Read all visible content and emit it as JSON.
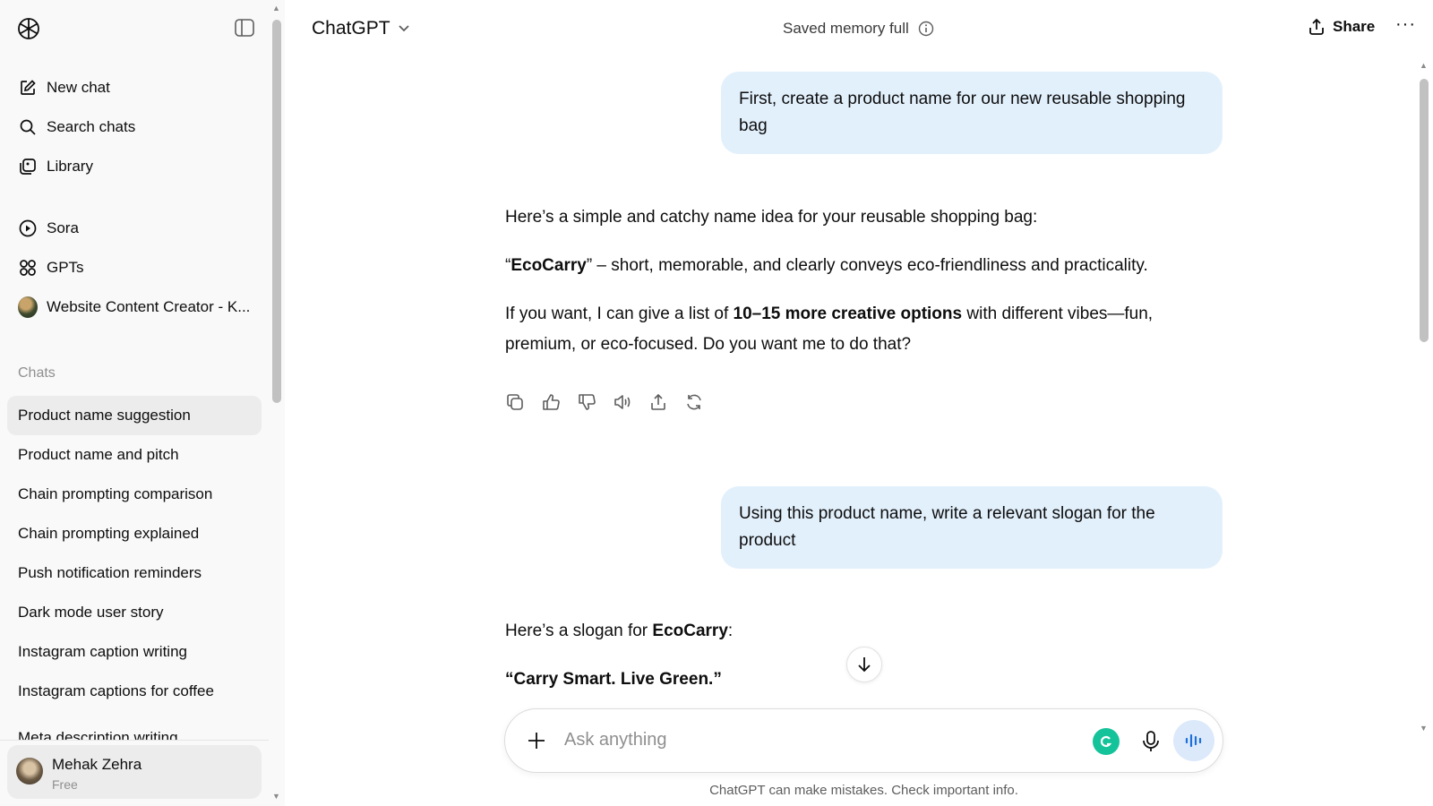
{
  "sidebar": {
    "top_items": [
      {
        "label": "New chat",
        "icon": "edit-icon"
      },
      {
        "label": "Search chats",
        "icon": "search-icon"
      },
      {
        "label": "Library",
        "icon": "library-icon"
      }
    ],
    "mid_items": [
      {
        "label": "Sora",
        "icon": "play-circle-icon"
      },
      {
        "label": "GPTs",
        "icon": "grid-icon"
      },
      {
        "label": "Website Content Creator - K...",
        "icon": "gpt-avatar-icon"
      }
    ],
    "section_label": "Chats",
    "chats": [
      "Product name suggestion",
      "Product name and pitch",
      "Chain prompting comparison",
      "Chain prompting explained",
      "Push notification reminders",
      "Dark mode user story",
      "Instagram caption writing",
      "Instagram captions for coffee",
      "Meta description writing"
    ],
    "active_chat_index": 0,
    "user": {
      "name": "Mehak Zehra",
      "plan": "Free"
    }
  },
  "header": {
    "model": "ChatGPT",
    "memory_status": "Saved memory full",
    "share_label": "Share"
  },
  "conversation": {
    "user_message_1": "First, create a product name for our new reusable shopping bag",
    "reply_1": {
      "intro": "Here’s a simple and catchy name idea for your reusable shopping bag:",
      "name_quote_open": "“",
      "name": "EcoCarry",
      "name_quote_close": "”",
      "name_desc": " – short, memorable, and clearly conveys eco-friendliness and practicality.",
      "offer_pre": "If you want, I can give a list of ",
      "offer_bold": "10–15 more creative options",
      "offer_post": " with different vibes—fun, premium, or eco-focused. Do you want me to do that?"
    },
    "user_message_2": "Using this product name, write a relevant slogan for the product",
    "reply_2": {
      "intro_pre": "Here’s a slogan for ",
      "intro_bold": "EcoCarry",
      "intro_post": ":",
      "slogan": "“Carry Smart. Live Green.”"
    }
  },
  "composer": {
    "placeholder": "Ask anything",
    "disclaimer": "ChatGPT can make mistakes. Check important info."
  }
}
